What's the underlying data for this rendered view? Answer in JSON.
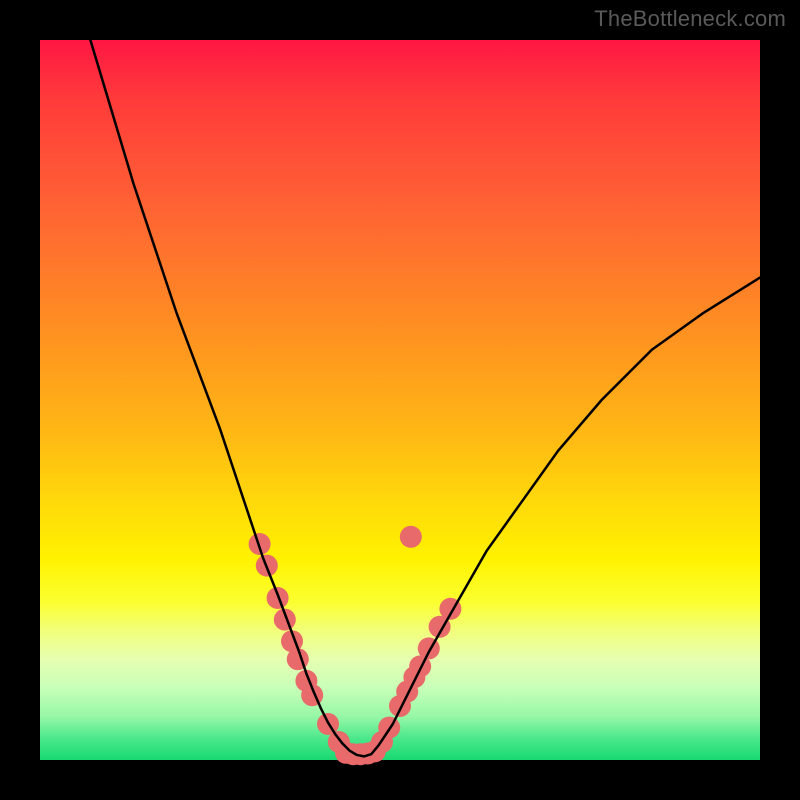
{
  "watermark": "TheBottleneck.com",
  "chart_data": {
    "type": "line",
    "title": "",
    "xlabel": "",
    "ylabel": "",
    "xlim": [
      0,
      100
    ],
    "ylim": [
      0,
      100
    ],
    "grid": false,
    "legend": false,
    "series": [
      {
        "name": "curve",
        "color": "#000000",
        "x": [
          7,
          10,
          13,
          16,
          19,
          22,
          25,
          27,
          29,
          31,
          33,
          34.5,
          36,
          37,
          38,
          39,
          40,
          41,
          42,
          43,
          44,
          45,
          46,
          47,
          49,
          51,
          54,
          58,
          62,
          67,
          72,
          78,
          85,
          92,
          100
        ],
        "y": [
          100,
          90,
          80,
          71,
          62,
          54,
          46,
          40,
          34,
          28,
          23,
          19,
          15,
          12,
          9.5,
          7.2,
          5.2,
          3.6,
          2.3,
          1.3,
          0.7,
          0.5,
          0.8,
          2.0,
          5.0,
          9.0,
          15,
          22,
          29,
          36,
          43,
          50,
          57,
          62,
          67
        ]
      }
    ],
    "markers": [
      {
        "name": "dots-left",
        "shape": "circle",
        "color": "#e86a6a",
        "radius_px": 11,
        "points": [
          {
            "x": 30.5,
            "y": 30
          },
          {
            "x": 31.5,
            "y": 27
          },
          {
            "x": 33.0,
            "y": 22.5
          },
          {
            "x": 34.0,
            "y": 19.5
          },
          {
            "x": 35.0,
            "y": 16.5
          },
          {
            "x": 35.8,
            "y": 14.0
          },
          {
            "x": 37.0,
            "y": 11.0
          },
          {
            "x": 37.8,
            "y": 9.0
          },
          {
            "x": 40.0,
            "y": 5.0
          },
          {
            "x": 41.5,
            "y": 2.5
          }
        ]
      },
      {
        "name": "dots-bottom",
        "shape": "circle",
        "color": "#e86a6a",
        "radius_px": 11,
        "points": [
          {
            "x": 42.5,
            "y": 1.0
          },
          {
            "x": 43.5,
            "y": 0.8
          },
          {
            "x": 44.5,
            "y": 0.8
          },
          {
            "x": 45.5,
            "y": 0.9
          },
          {
            "x": 46.5,
            "y": 1.2
          }
        ]
      },
      {
        "name": "dots-right",
        "shape": "circle",
        "color": "#e86a6a",
        "radius_px": 11,
        "points": [
          {
            "x": 47.5,
            "y": 2.5
          },
          {
            "x": 48.5,
            "y": 4.5
          },
          {
            "x": 50.0,
            "y": 7.5
          },
          {
            "x": 51.0,
            "y": 9.5
          },
          {
            "x": 52.0,
            "y": 11.5
          },
          {
            "x": 52.8,
            "y": 13.0
          },
          {
            "x": 54.0,
            "y": 15.5
          },
          {
            "x": 55.5,
            "y": 18.5
          },
          {
            "x": 57.0,
            "y": 21.0
          },
          {
            "x": 51.5,
            "y": 31.0
          }
        ]
      }
    ]
  }
}
